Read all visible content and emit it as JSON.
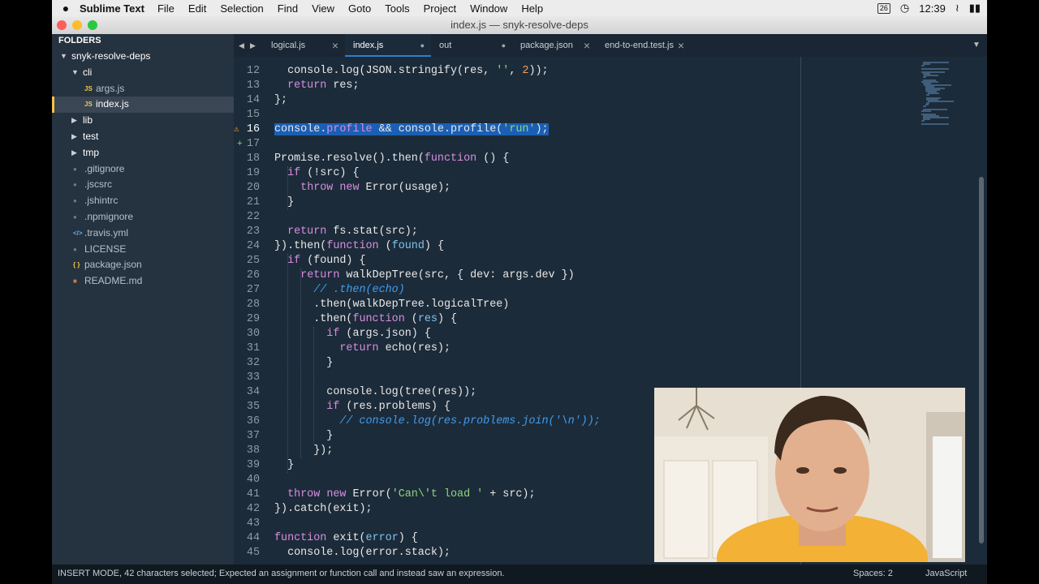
{
  "menubar": {
    "app_name": "Sublime Text",
    "items": [
      "File",
      "Edit",
      "Selection",
      "Find",
      "View",
      "Goto",
      "Tools",
      "Project",
      "Window",
      "Help"
    ],
    "calendar_day": "26",
    "time": "12:39"
  },
  "window": {
    "title": "index.js — snyk-resolve-deps"
  },
  "sidebar": {
    "header": "FOLDERS",
    "tree": [
      {
        "label": "snyk-resolve-deps",
        "type": "folder",
        "open": true,
        "depth": 0
      },
      {
        "label": "cli",
        "type": "folder",
        "open": true,
        "depth": 1
      },
      {
        "label": "args.js",
        "type": "file",
        "icon": "JS",
        "depth": 2
      },
      {
        "label": "index.js",
        "type": "file",
        "icon": "JS",
        "depth": 2,
        "selected": true
      },
      {
        "label": "lib",
        "type": "folder",
        "open": false,
        "depth": 1
      },
      {
        "label": "test",
        "type": "folder",
        "open": false,
        "depth": 1
      },
      {
        "label": "tmp",
        "type": "folder",
        "open": false,
        "depth": 1
      },
      {
        "label": ".gitignore",
        "type": "file",
        "icon": "dot",
        "depth": 1
      },
      {
        "label": ".jscsrc",
        "type": "file",
        "icon": "dot",
        "depth": 1
      },
      {
        "label": ".jshintrc",
        "type": "file",
        "icon": "dot",
        "depth": 1
      },
      {
        "label": ".npmignore",
        "type": "file",
        "icon": "dot",
        "depth": 1
      },
      {
        "label": ".travis.yml",
        "type": "file",
        "icon": "code",
        "depth": 1
      },
      {
        "label": "LICENSE",
        "type": "file",
        "icon": "dot",
        "depth": 1
      },
      {
        "label": "package.json",
        "type": "file",
        "icon": "braces",
        "depth": 1
      },
      {
        "label": "README.md",
        "type": "file",
        "icon": "md",
        "depth": 1
      }
    ]
  },
  "tabs": [
    {
      "label": "logical.js",
      "state": "close",
      "active": false
    },
    {
      "label": "index.js",
      "state": "dirty",
      "active": true
    },
    {
      "label": "out",
      "state": "dirty",
      "active": false
    },
    {
      "label": "package.json",
      "state": "close",
      "active": false
    },
    {
      "label": "end-to-end.test.js",
      "state": "close",
      "active": false
    }
  ],
  "editor": {
    "current_line": 16,
    "lines": [
      {
        "n": "12",
        "code": "  console.log(JSON.stringify(res, '', 2));"
      },
      {
        "n": "13",
        "code": "  return res;"
      },
      {
        "n": "14",
        "code": "};"
      },
      {
        "n": "15",
        "code": ""
      },
      {
        "n": "16",
        "code": "console.profile && console.profile('run');",
        "mark": "warning"
      },
      {
        "n": "17",
        "code": "",
        "mark": "added"
      },
      {
        "n": "18",
        "code": "Promise.resolve().then(function () {"
      },
      {
        "n": "19",
        "code": "  if (!src) {"
      },
      {
        "n": "20",
        "code": "    throw new Error(usage);"
      },
      {
        "n": "21",
        "code": "  }"
      },
      {
        "n": "22",
        "code": ""
      },
      {
        "n": "23",
        "code": "  return fs.stat(src);"
      },
      {
        "n": "24",
        "code": "}).then(function (found) {"
      },
      {
        "n": "25",
        "code": "  if (found) {"
      },
      {
        "n": "26",
        "code": "    return walkDepTree(src, { dev: args.dev })"
      },
      {
        "n": "27",
        "code": "      // .then(echo)"
      },
      {
        "n": "28",
        "code": "      .then(walkDepTree.logicalTree)"
      },
      {
        "n": "29",
        "code": "      .then(function (res) {"
      },
      {
        "n": "30",
        "code": "        if (args.json) {"
      },
      {
        "n": "31",
        "code": "          return echo(res);"
      },
      {
        "n": "32",
        "code": "        }"
      },
      {
        "n": "33",
        "code": ""
      },
      {
        "n": "34",
        "code": "        console.log(tree(res));"
      },
      {
        "n": "35",
        "code": "        if (res.problems) {"
      },
      {
        "n": "36",
        "code": "          // console.log(res.problems.join('\\n'));"
      },
      {
        "n": "37",
        "code": "        }"
      },
      {
        "n": "38",
        "code": "      });"
      },
      {
        "n": "39",
        "code": "  }"
      },
      {
        "n": "40",
        "code": ""
      },
      {
        "n": "41",
        "code": "  throw new Error('Can\\'t load ' + src);"
      },
      {
        "n": "42",
        "code": "}).catch(exit);"
      },
      {
        "n": "43",
        "code": ""
      },
      {
        "n": "44",
        "code": "function exit(error) {"
      },
      {
        "n": "45",
        "code": "  console.log(error.stack);"
      }
    ]
  },
  "statusbar": {
    "message": "INSERT MODE, 42 characters selected; Expected an assignment or function call and instead saw an expression.",
    "spaces": "Spaces: 2",
    "syntax": "JavaScript"
  },
  "colors": {
    "editor_bg": "#1c2b39",
    "sidebar_bg": "#25323f",
    "selection": "#1b5fb4",
    "keyword": "#d88de0",
    "string": "#8fd67d",
    "number": "#f2a060",
    "comment": "#3f9df0"
  }
}
